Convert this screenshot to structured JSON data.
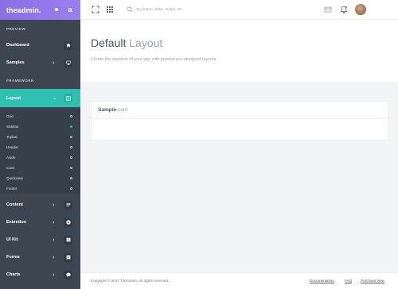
{
  "brand": {
    "logo": "theadmin.",
    "badge": "a"
  },
  "sidebar": {
    "section_preview": "PREVIEW",
    "section_framework": "FRAMEWORK",
    "items": [
      {
        "label": "Dashboard",
        "icon": "home-icon"
      },
      {
        "label": "Samples",
        "icon": "monitor-icon"
      },
      {
        "label": "Layout",
        "icon": "layout-icon"
      },
      {
        "label": "Content",
        "icon": "list-icon"
      },
      {
        "label": "Extention",
        "icon": "plus-icon"
      },
      {
        "label": "UI Kit",
        "icon": "book-icon"
      },
      {
        "label": "Forms",
        "icon": "check-icon"
      },
      {
        "label": "Charts",
        "icon": "chat-icon"
      }
    ],
    "layout_submenu": [
      "Grid",
      "Sidebar",
      "Topbar",
      "Header",
      "Aside",
      "Card",
      "Quickview",
      "Footer"
    ],
    "active_submenu": "Sidebar"
  },
  "topbar": {
    "search_placeholder": "Try button, slider, modal, etc."
  },
  "header": {
    "title_strong": "Default",
    "title_light": "Layout",
    "subtitle": "Create the skeleton of your app with popular pre-designed layouts."
  },
  "card": {
    "title_strong": "Sample",
    "title_light": "card"
  },
  "footer": {
    "copyright": "Copyright © 2017 TheAdmin. All rights reserved.",
    "links": [
      "Documentation",
      "FAQ",
      "Purchase Now"
    ]
  },
  "colors": {
    "brand": "#8a6ee3",
    "accent": "#2fc0b0",
    "sidebar_bg": "#3c4650"
  }
}
